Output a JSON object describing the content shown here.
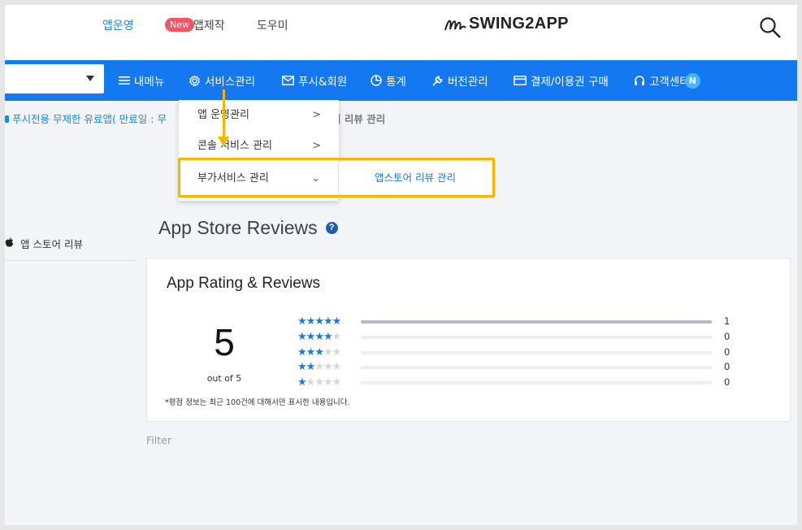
{
  "header": {
    "links": [
      {
        "label": "앱운영",
        "active": true
      },
      {
        "label": "앱제작",
        "badge": "New"
      },
      {
        "label": "도우미"
      }
    ],
    "logo_text": "SWING2APP",
    "search_icon": "search-icon"
  },
  "nav": {
    "app_select_value": "",
    "items": [
      {
        "label": "내메뉴",
        "icon": "hamburger-icon"
      },
      {
        "label": "서비스관리",
        "icon": "gear-icon"
      },
      {
        "label": "푸시&회원",
        "icon": "mail-icon"
      },
      {
        "label": "통계",
        "icon": "pie-chart-icon"
      },
      {
        "label": "버전관리",
        "icon": "wrench-icon"
      },
      {
        "label": "결제/이용권 구매",
        "icon": "card-icon"
      },
      {
        "label": "고객센터",
        "icon": "headset-icon",
        "badge": "N"
      }
    ]
  },
  "notice": {
    "text": "푸시전용 무제한 유료앱( 만료일 : 무",
    "crumb_tail": "어 리뷰 관리"
  },
  "dropdown": {
    "items": [
      {
        "label": "앱 운영관리",
        "chevron": ">"
      },
      {
        "label": "콘솔 서비스 관리",
        "chevron": ">"
      },
      {
        "label": "부가서비스 관리",
        "chevron": "⌄"
      }
    ],
    "submenu_item": "앱스토어 리뷰 관리"
  },
  "sidebar": {
    "items": [
      {
        "label": "앱 스토어 리뷰",
        "icon": "apple-icon"
      }
    ]
  },
  "page": {
    "title": "App Store Reviews",
    "help": "?"
  },
  "rating_card": {
    "title": "App Rating & Reviews",
    "score": "5",
    "out_of": "out of 5",
    "note": "*평점 정보는 최근 100건에 대해서만 표시한 내용입니다.",
    "rows": [
      {
        "stars": 5,
        "count": "1",
        "fraction": 1.0
      },
      {
        "stars": 4,
        "count": "0",
        "fraction": 0
      },
      {
        "stars": 3,
        "count": "0",
        "fraction": 0
      },
      {
        "stars": 2,
        "count": "0",
        "fraction": 0
      },
      {
        "stars": 1,
        "count": "0",
        "fraction": 0
      }
    ]
  },
  "filter_label": "Filter",
  "colors": {
    "nav_bg": "#1478f1",
    "accent_blue": "#1a8ad8",
    "highlight": "#f7b500",
    "new_badge": "#f25563",
    "star_on": "#1a78e8"
  }
}
